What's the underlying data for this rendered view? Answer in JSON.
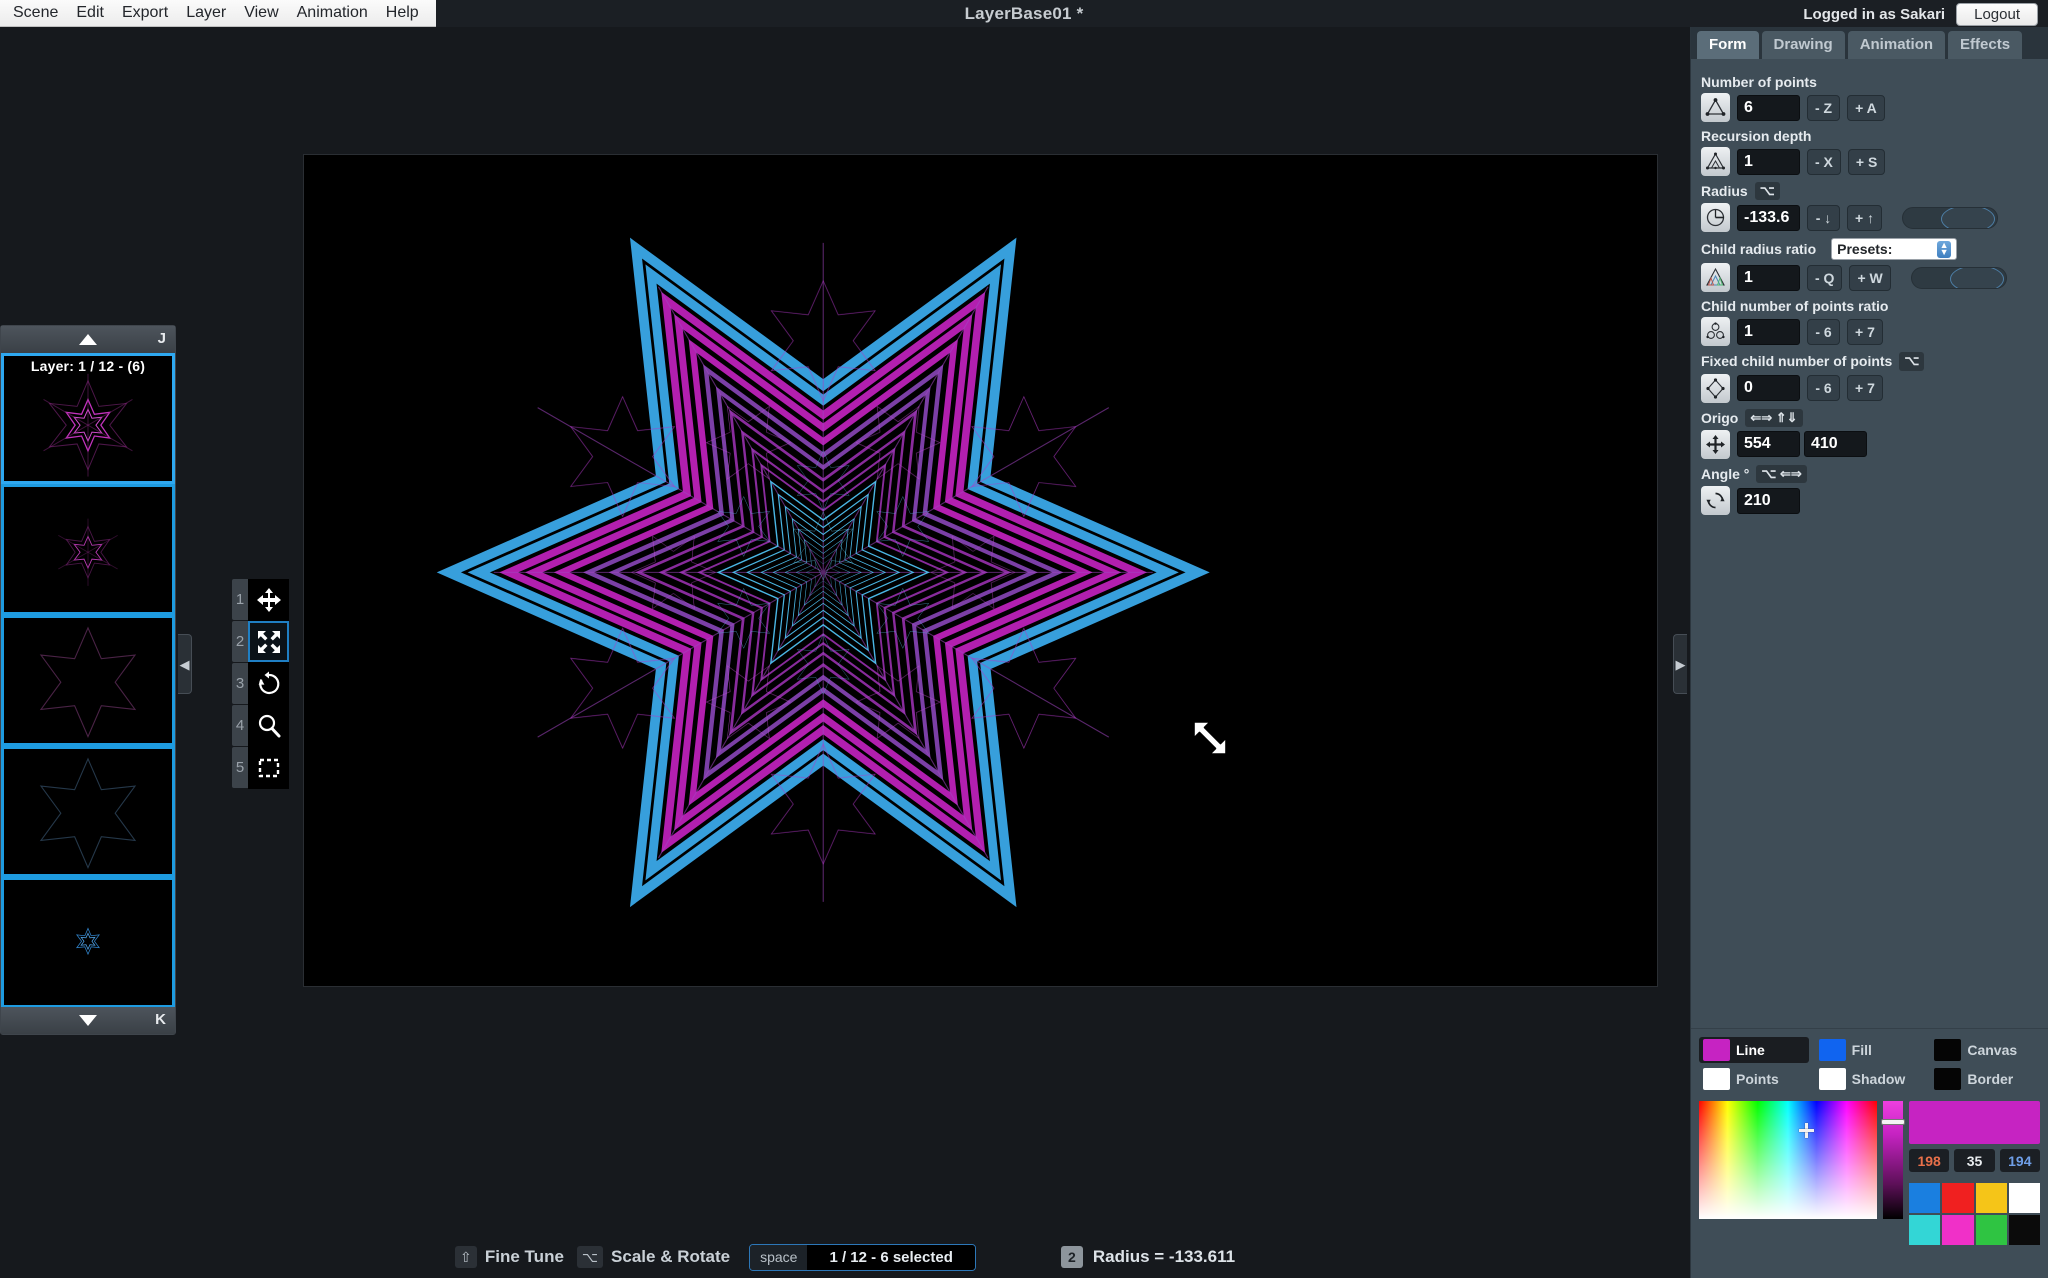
{
  "menu": {
    "items": [
      "Scene",
      "Edit",
      "Export",
      "Layer",
      "View",
      "Animation",
      "Help"
    ]
  },
  "titlebar": {
    "document_title": "LayerBase01 *",
    "login_text": "Logged in as Sakari",
    "logout_label": "Logout"
  },
  "layer_panel": {
    "scroll_up_key": "J",
    "scroll_down_key": "K",
    "current_layer_label": "Layer: 1 / 12 - (6)",
    "layers": [
      {
        "name": "layer-1",
        "kind": "fractal-star-magenta",
        "selected": true
      },
      {
        "name": "layer-2",
        "kind": "fractal-star-magenta-small",
        "selected": false
      },
      {
        "name": "layer-3",
        "kind": "star-outline-magenta",
        "selected": false
      },
      {
        "name": "layer-4",
        "kind": "star-outline-blue",
        "selected": false
      },
      {
        "name": "layer-5",
        "kind": "fractal-star-blue-tiny",
        "selected": false
      }
    ]
  },
  "tools": {
    "items": [
      {
        "num": "1",
        "name": "move-tool",
        "selected": false
      },
      {
        "num": "2",
        "name": "scale-tool",
        "selected": true
      },
      {
        "num": "3",
        "name": "rotate-tool",
        "selected": false
      },
      {
        "num": "4",
        "name": "zoom-tool",
        "selected": false
      },
      {
        "num": "5",
        "name": "marquee-select-tool",
        "selected": false
      }
    ]
  },
  "right_panel": {
    "tabs": [
      {
        "label": "Form",
        "active": true
      },
      {
        "label": "Drawing",
        "active": false
      },
      {
        "label": "Animation",
        "active": false
      },
      {
        "label": "Effects",
        "active": false
      }
    ],
    "fields": {
      "number_of_points": {
        "label": "Number of points",
        "value": "6",
        "dec_label": "- Z",
        "inc_label": "+ A"
      },
      "recursion_depth": {
        "label": "Recursion depth",
        "value": "1",
        "dec_label": "- X",
        "inc_label": "+ S"
      },
      "radius": {
        "label": "Radius",
        "modifier_badge": "⌥",
        "value": "-133.6",
        "dec_label": "- ↓",
        "inc_label": "+ ↑"
      },
      "child_radius_ratio": {
        "label": "Child radius ratio",
        "presets_label": "Presets:",
        "value": "1",
        "dec_label": "- Q",
        "inc_label": "+ W"
      },
      "child_number_of_points_ratio": {
        "label": "Child number of points ratio",
        "value": "1",
        "dec_label": "- 6",
        "inc_label": "+ 7"
      },
      "fixed_child_number_of_points": {
        "label": "Fixed child number of points",
        "modifier_badge": "⌥",
        "value": "0",
        "dec_label": "- 6",
        "inc_label": "+ 7"
      },
      "origo": {
        "label": "Origo",
        "badge_arrows": "⇐⇒ ⇑⇓",
        "value_x": "554",
        "value_y": "410"
      },
      "angle": {
        "label": "Angle °",
        "badge": "⌥ ⇐⇒",
        "value": "210"
      }
    }
  },
  "colors": {
    "swatches": [
      {
        "name": "Line",
        "hex": "#c623c2",
        "active": true
      },
      {
        "name": "Fill",
        "hex": "#1064f0",
        "active": false
      },
      {
        "name": "Canvas",
        "hex": "#050505",
        "active": false
      },
      {
        "name": "Points",
        "hex": "#ffffff",
        "active": false
      },
      {
        "name": "Shadow",
        "hex": "#ffffff",
        "active": false
      },
      {
        "name": "Border",
        "hex": "#050505",
        "active": false
      }
    ],
    "current_hex": "#c623c2",
    "rgb": {
      "r": "198",
      "g": "35",
      "b": "194"
    },
    "rgb_label_colors": {
      "r": "#e8704a",
      "g": "#e8ecef",
      "b": "#6f9fe8"
    },
    "palette": [
      "#1a7fe0",
      "#f02020",
      "#f5c518",
      "#ffffff",
      "#33d6d6",
      "#f030c8",
      "#2fc442",
      "#0b0b0b"
    ]
  },
  "statusbar": {
    "fine_tune_key": "⇧",
    "fine_tune_label": "Fine Tune",
    "scale_rotate_key": "⌥",
    "scale_rotate_label": "Scale & Rotate",
    "selection_key": "space",
    "selection_text": "1 / 12 - 6 selected",
    "radius_key": "2",
    "radius_text": "Radius = -133.611"
  },
  "artwork": {
    "description": "recursive six-pointed star fractal",
    "line_color": "#c623c2",
    "fill_color": "#3aa8e8",
    "points": 6,
    "angle": 210
  }
}
